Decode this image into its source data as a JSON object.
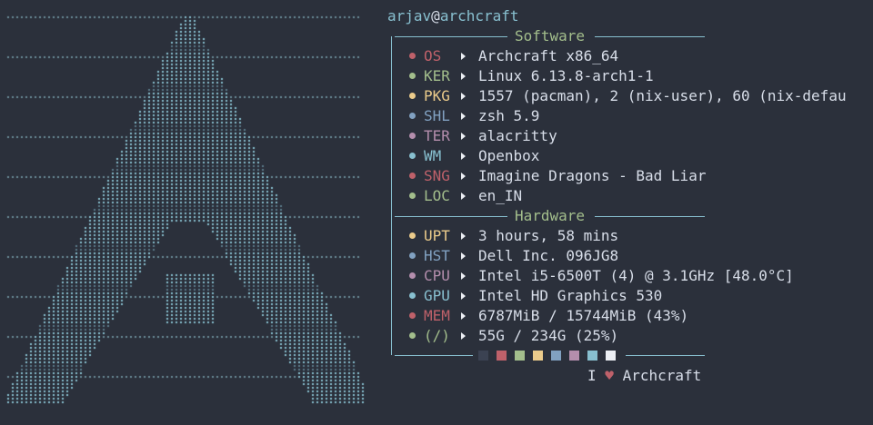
{
  "user": "arjav",
  "at": "@",
  "host": "archcraft",
  "software": {
    "title": "Software",
    "rows": [
      {
        "key": "OS",
        "value": "Archcraft x86_64",
        "color": "#bf616a"
      },
      {
        "key": "KER",
        "value": "Linux 6.13.8-arch1-1",
        "color": "#a3be8c"
      },
      {
        "key": "PKG",
        "value": "1557 (pacman), 2 (nix-user), 60 (nix-defau",
        "color": "#ebcb8b"
      },
      {
        "key": "SHL",
        "value": "zsh 5.9",
        "color": "#81a1c1"
      },
      {
        "key": "TER",
        "value": "alacritty",
        "color": "#b48ead"
      },
      {
        "key": "WM",
        "value": "Openbox",
        "color": "#88c0d0"
      },
      {
        "key": "SNG",
        "value": "Imagine Dragons - Bad Liar",
        "color": "#bf616a"
      },
      {
        "key": "LOC",
        "value": "en_IN",
        "color": "#a3be8c"
      }
    ]
  },
  "hardware": {
    "title": "Hardware",
    "rows": [
      {
        "key": "UPT",
        "value": "3 hours, 58 mins",
        "color": "#ebcb8b"
      },
      {
        "key": "HST",
        "value": "Dell Inc. 096JG8",
        "color": "#81a1c1"
      },
      {
        "key": "CPU",
        "value": "Intel i5-6500T (4) @ 3.1GHz [48.0°C]",
        "color": "#b48ead"
      },
      {
        "key": "GPU",
        "value": "Intel HD Graphics 530",
        "color": "#88c0d0"
      },
      {
        "key": "MEM",
        "value": "6787MiB / 15744MiB (43%)",
        "color": "#bf616a"
      },
      {
        "key": "(/)",
        "value": "55G / 234G (25%)",
        "color": "#a3be8c"
      }
    ]
  },
  "palette": [
    "#3b4252",
    "#bf616a",
    "#a3be8c",
    "#ebcb8b",
    "#81a1c1",
    "#b48ead",
    "#88c0d0",
    "#eceff4"
  ],
  "footer": {
    "pre": "I",
    "heart": "♥",
    "post": "Archcraft",
    "heart_color": "#bf616a"
  },
  "colors": {
    "bg": "#2b303b",
    "accent": "#88c0d0",
    "text": "#d8dee9",
    "user": "#88c0d0",
    "title": "#a3be8c"
  }
}
